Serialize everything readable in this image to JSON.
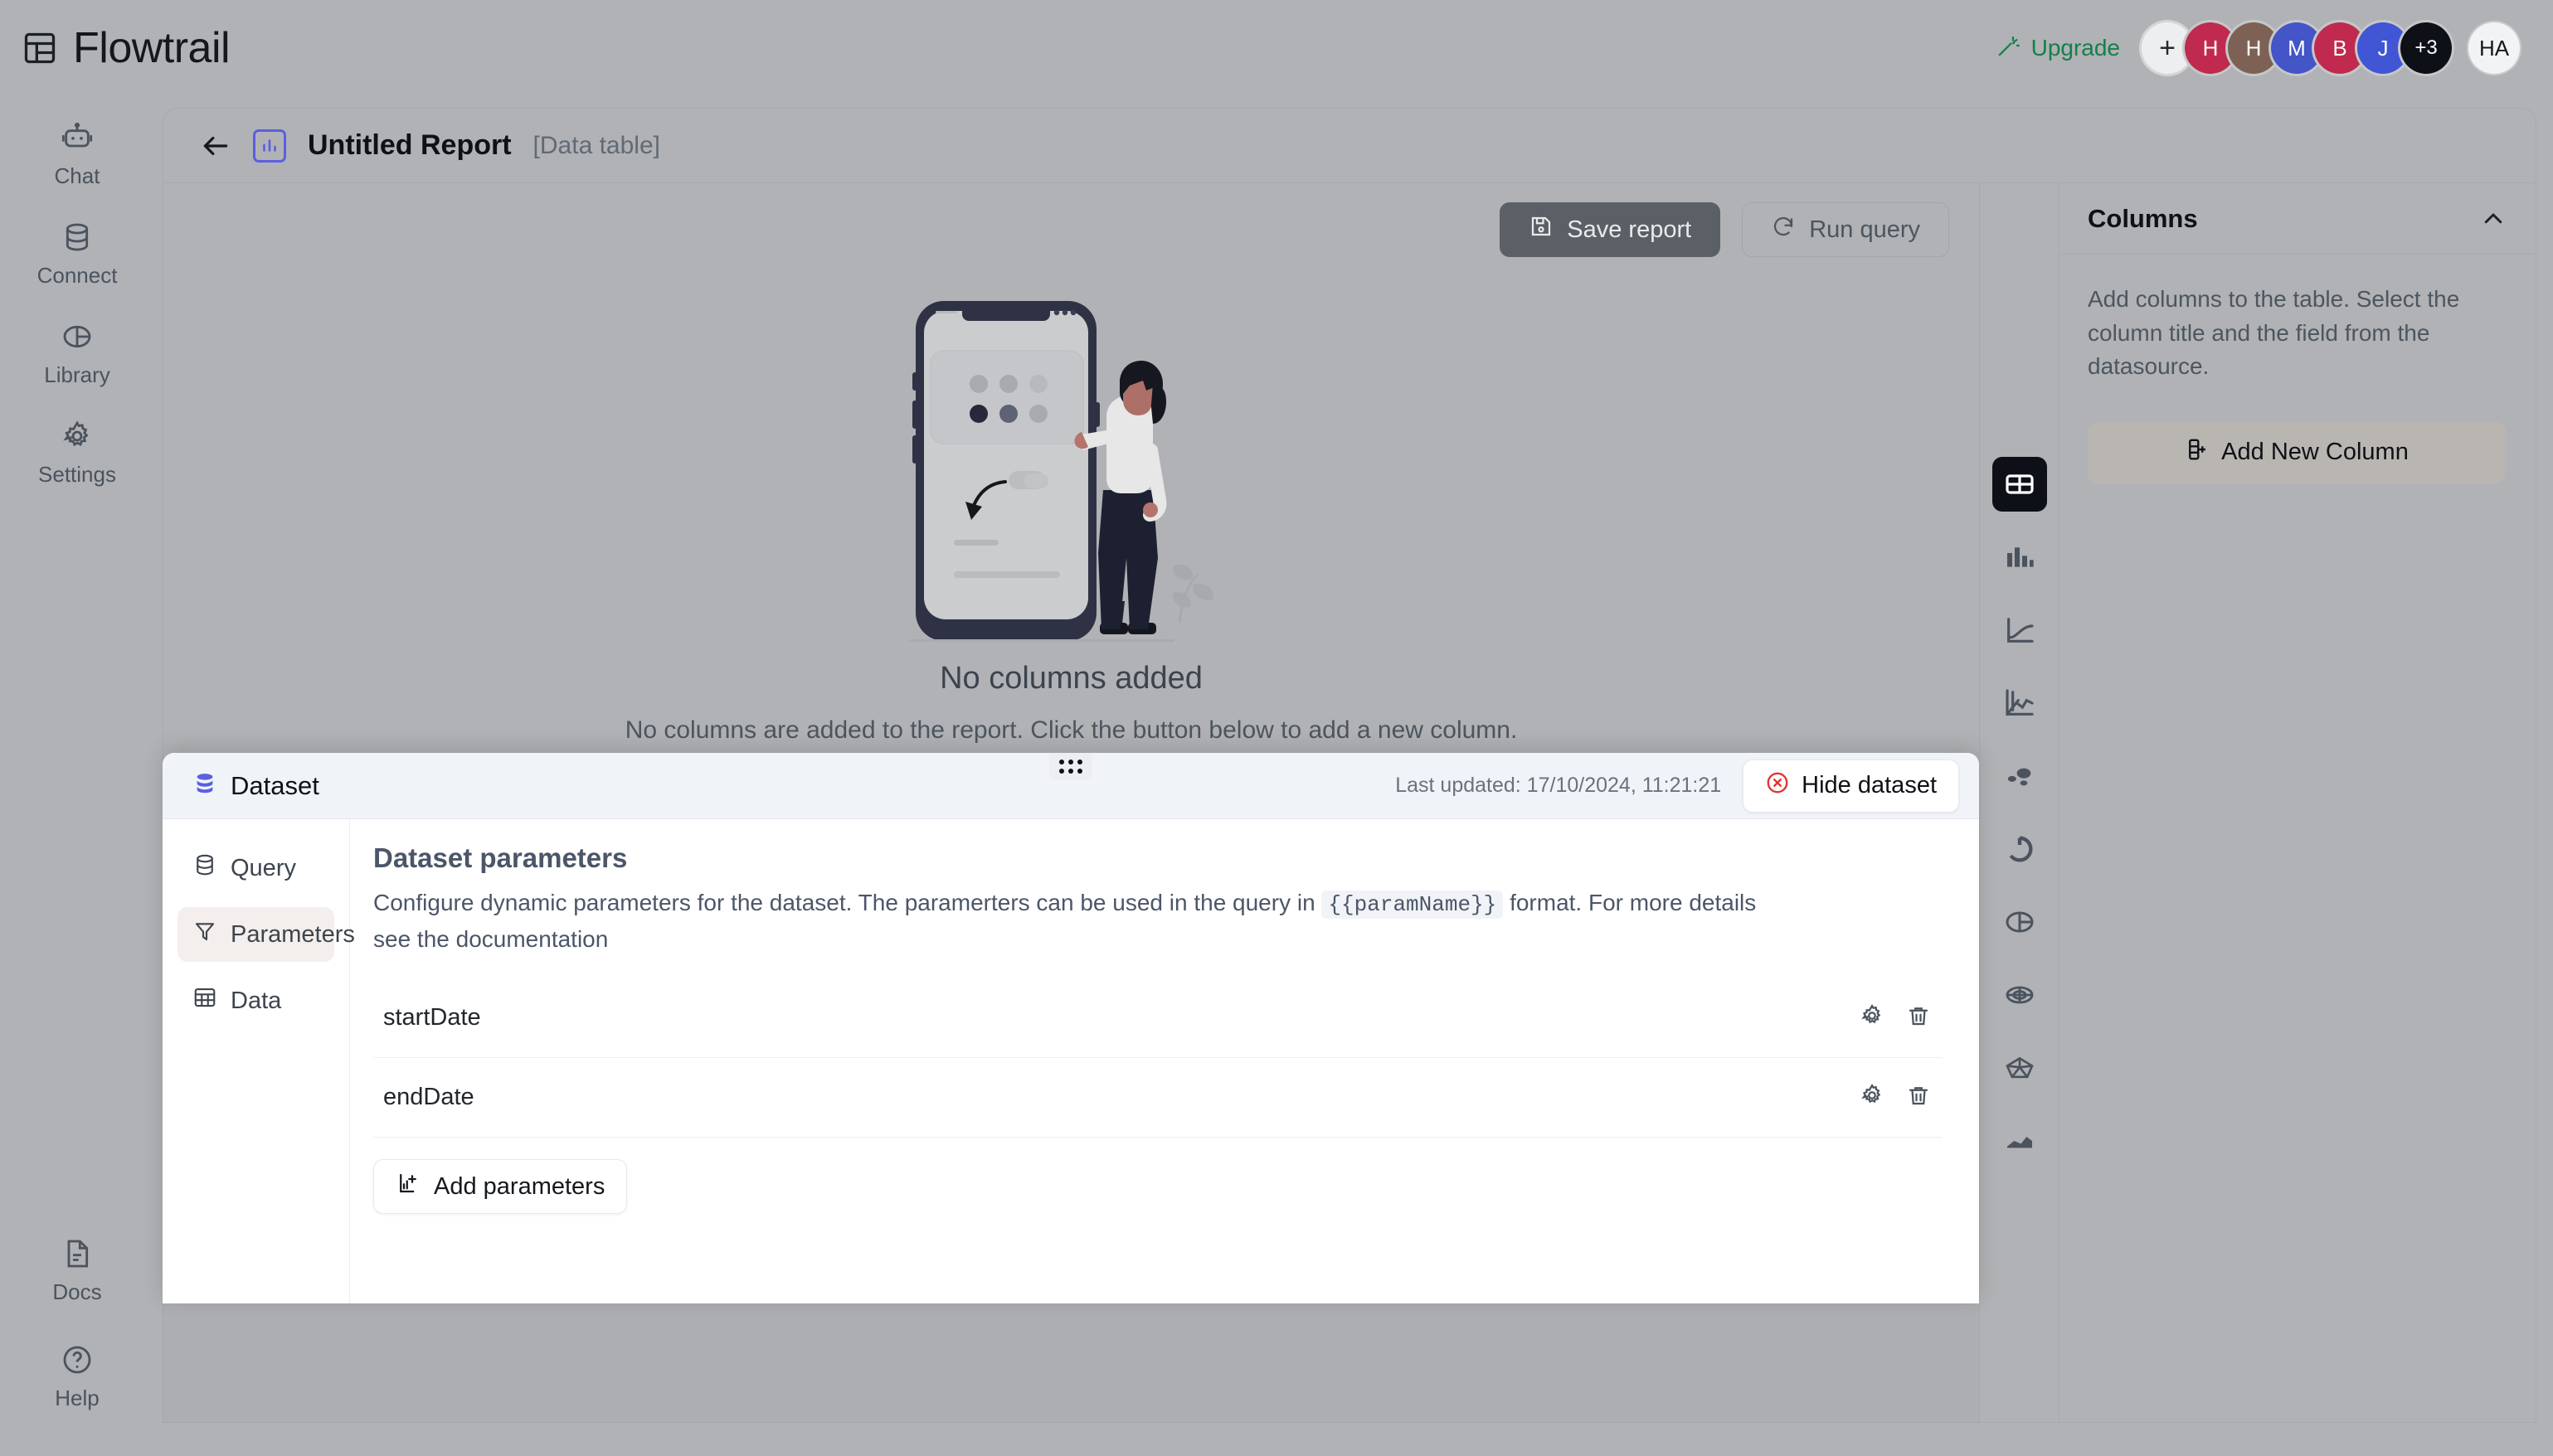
{
  "app": {
    "name": "Flowtrail",
    "logo_icon": "layout-grid-icon"
  },
  "topbar": {
    "upgrade_label": "Upgrade",
    "upgrade_icon": "magic-wand-icon",
    "upgrade_color": "#14804a",
    "add_member_label": "+",
    "avatars": [
      {
        "initial": "H",
        "color": "#c02a4e"
      },
      {
        "initial": "H",
        "color": "#7d6155"
      },
      {
        "initial": "M",
        "color": "#4355c7"
      },
      {
        "initial": "B",
        "color": "#c02a4e"
      },
      {
        "initial": "J",
        "color": "#4056d4"
      },
      {
        "initial": "+3",
        "color": "#0d1117"
      }
    ],
    "current_user_initials": "HA"
  },
  "sidebar": {
    "top_items": [
      {
        "label": "Chat",
        "icon": "robot-icon"
      },
      {
        "label": "Connect",
        "icon": "database-icon"
      },
      {
        "label": "Library",
        "icon": "pie-chart-icon"
      },
      {
        "label": "Settings",
        "icon": "gear-icon"
      }
    ],
    "bottom_items": [
      {
        "label": "Docs",
        "icon": "file-text-icon"
      },
      {
        "label": "Help",
        "icon": "question-circle-icon"
      }
    ]
  },
  "report": {
    "back_icon": "arrow-left-icon",
    "type_icon": "bar-chart-icon",
    "title": "Untitled Report",
    "type_label": "[Data table]",
    "accent_color": "#5b5fe0",
    "toolbar": {
      "save_label": "Save report",
      "save_icon": "save-icon",
      "run_label": "Run query",
      "run_icon": "refresh-icon"
    },
    "empty_state": {
      "title": "No columns added",
      "subtitle": "No columns are added to the report. Click the button below to add a new column.",
      "illustration": "person-with-phone-illustration"
    },
    "chart_types": [
      {
        "name": "table",
        "icon": "table-icon",
        "selected": true
      },
      {
        "name": "bar",
        "icon": "bar-chart-icon",
        "selected": false
      },
      {
        "name": "line",
        "icon": "line-chart-icon",
        "selected": false
      },
      {
        "name": "composed",
        "icon": "axis-line-chart-icon",
        "selected": false
      },
      {
        "name": "scatter",
        "icon": "scatter-plot-icon",
        "selected": false
      },
      {
        "name": "donut",
        "icon": "donut-chart-icon",
        "selected": false
      },
      {
        "name": "pie",
        "icon": "pie-chart-icon",
        "selected": false
      },
      {
        "name": "radar",
        "icon": "radar-chart-icon",
        "selected": false
      },
      {
        "name": "polygon",
        "icon": "polygon-chart-icon",
        "selected": false
      },
      {
        "name": "area",
        "icon": "area-chart-icon",
        "selected": false
      }
    ]
  },
  "columns_panel": {
    "title": "Columns",
    "collapse_icon": "chevron-up-icon",
    "description": "Add columns to the table. Select the column title and the field from the datasource.",
    "add_button_label": "Add New Column",
    "add_button_icon": "add-column-icon"
  },
  "dataset": {
    "drag_handle_icon": "drag-dots-icon",
    "title": "Dataset",
    "title_icon": "database-icon",
    "last_updated": "Last updated: 17/10/2024, 11:21:21",
    "hide_label": "Hide dataset",
    "hide_icon": "circle-x-icon",
    "hide_icon_color": "#e0342e",
    "nav": [
      {
        "label": "Query",
        "icon": "database-icon",
        "active": false
      },
      {
        "label": "Parameters",
        "icon": "filter-icon",
        "active": true
      },
      {
        "label": "Data",
        "icon": "table-icon",
        "active": false
      }
    ],
    "parameters_view": {
      "heading": "Dataset parameters",
      "description_part1": "Configure dynamic parameters for the dataset. The paramerters can be used in the query in",
      "description_code": "{{paramName}}",
      "description_part2": "format. For more details see the documentation",
      "rows": [
        {
          "name": "startDate",
          "settings_icon": "gear-icon",
          "delete_icon": "trash-icon"
        },
        {
          "name": "endDate",
          "settings_icon": "gear-icon",
          "delete_icon": "trash-icon"
        }
      ],
      "add_label": "Add parameters",
      "add_icon": "add-parameter-icon"
    }
  }
}
